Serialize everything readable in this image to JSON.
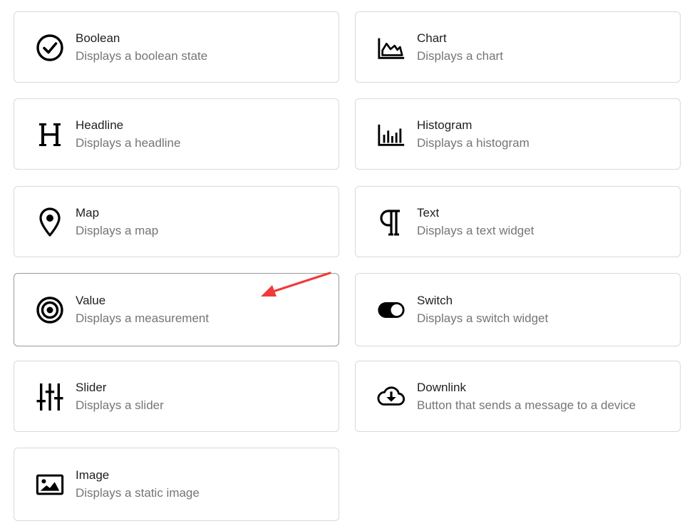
{
  "widgets": [
    {
      "title": "Boolean",
      "description": "Displays a boolean state",
      "icon": "check-circle-icon"
    },
    {
      "title": "Chart",
      "description": "Displays a chart",
      "icon": "area-chart-icon"
    },
    {
      "title": "Headline",
      "description": "Displays a headline",
      "icon": "letter-h-icon"
    },
    {
      "title": "Histogram",
      "description": "Displays a histogram",
      "icon": "bar-chart-icon"
    },
    {
      "title": "Map",
      "description": "Displays a map",
      "icon": "map-pin-icon"
    },
    {
      "title": "Text",
      "description": "Displays a text widget",
      "icon": "pilcrow-icon"
    },
    {
      "title": "Value",
      "description": "Displays a measurement",
      "icon": "target-icon"
    },
    {
      "title": "Switch",
      "description": "Displays a switch widget",
      "icon": "toggle-icon"
    },
    {
      "title": "Slider",
      "description": "Displays a slider",
      "icon": "sliders-icon"
    },
    {
      "title": "Downlink",
      "description": "Button that sends a message to a device",
      "icon": "cloud-download-icon"
    },
    {
      "title": "Image",
      "description": "Displays a static image",
      "icon": "image-icon"
    }
  ],
  "annotation_color": "#ef3b3b"
}
